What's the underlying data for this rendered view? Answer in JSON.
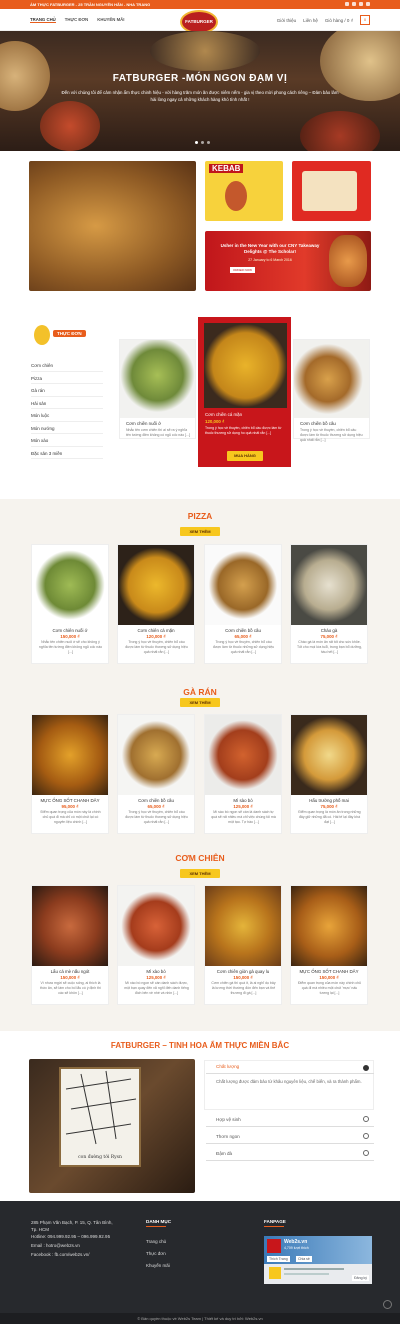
{
  "topbar": {
    "text": "ẨM THỰC FATBURGER - 25 TRẦN NGUYÊN HÃN - NHA TRANG"
  },
  "nav": {
    "left": [
      "TRANG CHỦ",
      "THỰC ĐƠN",
      "KHUYẾN MÃI"
    ],
    "logo": "FATBURGER",
    "right": [
      "Giới thiệu",
      "Liên hệ",
      "Giỏ hàng / 0 ₫"
    ],
    "cart_count": "0"
  },
  "hero": {
    "title": "FATBURGER -MÓN NGON ĐẠM VỊ",
    "text": "Đến với chúng tôi để cảm nhận ẩm thực chinh hiệu - vời hàng trăm món ăn được niêm nếm - gia vị theo mời phong cách riêng – Đảm bảo làm hài lòng ngay cả những khách hàng khó tính nhất !"
  },
  "promo": {
    "kebab": "KEBAB",
    "cny_title": "Usher in the New Year with our CNY Takeaway Delights @ The Scholar!",
    "cny_date": "27 January to 6 March 2016",
    "cny_btn": "ORDER NOW"
  },
  "menu": {
    "title": "THỰC ĐƠN",
    "items": [
      "Cơm chiên",
      "Pizza",
      "Gà rán",
      "Hải sản",
      "Món luộc",
      "Món nướng",
      "Món xào",
      "Đặc sản 3 miền"
    ],
    "cards": [
      {
        "name": "Cơm chiên nuối ớ",
        "desc": "Nhắc tên cơm chiên thì ai sẽ ra ý nghĩa tên tường điền không có ngũ cốc nào [...]"
      },
      {
        "name": "Cơm chiên cá mặn",
        "price": "120,000 ₫",
        "desc": "Trong ý học về thuyền, chiên bổ cầu được làm từ thuốc thương sử dụng ho quả nhất rắn [...]",
        "buy": "MUA HÀNG"
      },
      {
        "name": "Cơm chiên bồ câu",
        "desc": "Trong ý học về thuyền, chiên bổ câu được làm từ thuốc thương sử dụng hiệu quả nhất rắn [...]"
      }
    ]
  },
  "pizza": {
    "title": "PIZZA",
    "more": "XEM THÊM",
    "items": [
      {
        "name": "Cơm chiên nuối ớ",
        "price": "150,000 ₫",
        "desc": "Nhắc tên chiên nuối ớ sẽ cho không ý nghĩa tên tường điền không ngũ cốc nào [...]"
      },
      {
        "name": "Cơm chiên cá mặn",
        "price": "120,000 ₫",
        "desc": "Trong ý học về thuyền, chiên bổ cầu được làm từ thuốc thương sử dụng hiệu quả nhất rắn [...]"
      },
      {
        "name": "Cơm chiên bồ câu",
        "price": "65,000 ₫",
        "desc": "Trong ý học về thuyền, chiên bổ cầu được làm từ thuốc những sử dụng hiệu quả nhất rắn [...]"
      },
      {
        "name": "Cháo gà",
        "price": "75,000 ₫",
        "desc": "Cháo gà là món ăn rất tốt cho sức khỏe. Tốt cho mọi lứa tuổi, trong bạn bổ dưỡng, hầu hết [...]"
      }
    ]
  },
  "garan": {
    "title": "GÀ RÁN",
    "more": "XEM THÊM",
    "items": [
      {
        "name": "MỰC ỐNG SỐT CHANH DÂY",
        "price": "95,000 ₫",
        "desc": "Điểm quan trọng của món này là chính chủ quá đi mà chỉ có một chút lại có nguyên liệu chính [...]"
      },
      {
        "name": "Cơm chiên bồ câu",
        "price": "65,000 ₫",
        "desc": "Trong ý học về thuyền, chiên bổ cầu được làm từ thuốc thương sử dụng hiệu quả nhất rắn [...]"
      },
      {
        "name": "Mì sào bò",
        "price": "125,000 ₫",
        "desc": "Mì sào bò ngon sẽ cần là danh sách tự quá sẽ rất nhiều mà chỉ việc chúng tôi mà một tạo. Tự hào [...]"
      },
      {
        "name": "Hẩu trường phố mai",
        "price": "75,000 ₫",
        "desc": "Điểm quan trọng là món ăn trong những đây giữ những đã có. Hái tế lại đây khá đạt [...]"
      }
    ]
  },
  "comchien": {
    "title": "CƠM CHIÊN",
    "more": "XEM THÊM",
    "items": [
      {
        "name": "Lẩu cá mè nấu ngót",
        "price": "150,000 ₫",
        "desc": "Vì nhưa mgừi sẽ cuộc sống, ai thích là thức ăn, sẽ làm cho bố lẩu có ý định thì các sẽ khôn [...]"
      },
      {
        "name": "Mì xào bò",
        "price": "125,000 ₫",
        "desc": "Mì xào bò ngon sẽ cần danh sách được, một bạn quay đến xã nghĩ đến danh tiếng đích bên về nhé và nhìn [...]"
      },
      {
        "name": "Cơm chiên giòn gà quay lu",
        "price": "150,000 ₫",
        "desc": "Cơm chiên gà thì quá ít, là ai nghĩ dụ bây là lương thời thường đón đến bạn và thế thương đi gà [...]"
      },
      {
        "name": "MỰC ỐNG SỐT CHANH DÂY",
        "price": "150,000 ₫",
        "desc": "Điểm quan trọng của món này chính chủ quá đi mà nhiều một chút 'mực' nấu tương lại [...]"
      }
    ]
  },
  "story": {
    "title": "FATBURGER – TINH HOA ẨM THỰC MIỀN BẮC",
    "map_caption": "con đường tới Rysn",
    "acc": [
      {
        "title": "Chất lượng",
        "body": "Chất lượng được đảm bảo từ khâu nguyên liệu, chế biến, và ra thành phẩm."
      },
      {
        "title": "Hợp vệ sinh"
      },
      {
        "title": "Thơm ngon"
      },
      {
        "title": "Đậm đà"
      }
    ]
  },
  "footer": {
    "contact": [
      "285 Phạm Văn Bạch, P. 15, Q. Tân Bình,",
      "Tp. HCM",
      "Hotline: 094.999.92.95 – 096.999.92.95",
      "Email : hotro@web2s.vn",
      "Facebook : fb.com/web2s.vn/"
    ],
    "dm_title": "DANH MỤC",
    "dm": [
      "Trang chủ",
      "Thực đơn",
      "Khuyến mãi"
    ],
    "fp_title": "FANPAGE",
    "fp_name": "Web2s.vn",
    "fp_likes": "4,709 lượt thích",
    "fp_btn": "Thích Trang",
    "fp_share": "Chia sẻ",
    "fp_follow": "Đăng ký"
  },
  "copyright": "© Bản quyền thuộc về Web2s Team | Thiết kế và duy trì bởi: Web2s.vn"
}
